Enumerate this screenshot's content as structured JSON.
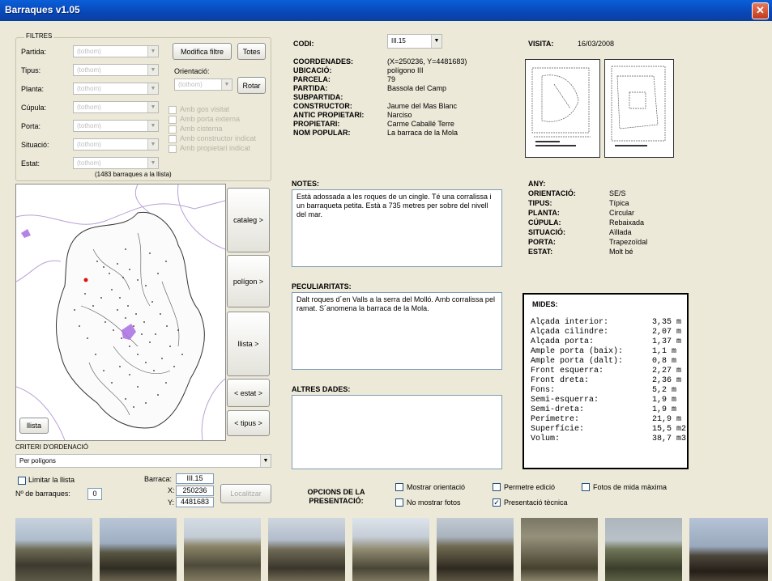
{
  "window": {
    "title": "Barraques v1.05"
  },
  "filters": {
    "group_label": "FILTRES",
    "rows": [
      {
        "label": "Partida:",
        "value": "(tothom)"
      },
      {
        "label": "Tipus:",
        "value": "(tothom)"
      },
      {
        "label": "Planta:",
        "value": "(tothom)"
      },
      {
        "label": "Cúpula:",
        "value": "(tothom)"
      },
      {
        "label": "Porta:",
        "value": "(tothom)"
      },
      {
        "label": "Situació:",
        "value": "(tothom)"
      },
      {
        "label": "Estat:",
        "value": "(tothom)"
      }
    ],
    "modify_button": "Modifica filtre",
    "all_button": "Totes",
    "orientation_label": "Orientació:",
    "orientation_value": "(tothom)",
    "rotate_button": "Rotar",
    "checkboxes": [
      "Amb gos visitat",
      "Amb porta externa",
      "Amb cisterna",
      "Amb constructor indicat",
      "Amb propietari indicat"
    ],
    "count_text": "(1483 barraques a la llista)"
  },
  "map_buttons": [
    "cataleg >",
    "polígon >",
    "llista >",
    "< estat >",
    "< tipus >"
  ],
  "llista_button": "llista",
  "sort": {
    "label": "CRITERI D'ORDENACIÓ",
    "value": "Per polígons"
  },
  "bottom_left": {
    "limit_label": "Limitar la llista",
    "count_label": "Nº de barraques:",
    "count_value": "0",
    "barraca_label": "Barraca:",
    "barraca_value": "III.15",
    "x_label": "X:",
    "x_value": "250236",
    "y_label": "Y:",
    "y_value": "4481683",
    "locate_button": "Localitzar"
  },
  "details": {
    "code_label": "CODI:",
    "code_value": "III.15",
    "fields": [
      {
        "label": "COORDENADES:",
        "value": "(X=250236, Y=4481683)"
      },
      {
        "label": "UBICACIÓ:",
        "value": "polígono III"
      },
      {
        "label": "PARCELA:",
        "value": "79"
      },
      {
        "label": "PARTIDA:",
        "value": "Bassola del Camp"
      },
      {
        "label": "SUBPARTIDA:",
        "value": ""
      },
      {
        "label": "CONSTRUCTOR:",
        "value": "Jaume del Mas Blanc"
      },
      {
        "label": "ANTIC PROPIETARI:",
        "value": "Narciso"
      },
      {
        "label": "PROPIETARI:",
        "value": "Carme Caballé Terre"
      },
      {
        "label": "NOM POPULAR:",
        "value": "La barraca de la Mola"
      }
    ]
  },
  "visit": {
    "label": "VISITA:",
    "value": "16/03/2008"
  },
  "notes": {
    "label": "NOTES:",
    "text": "Està adossada a les roques de un cingle. Té una corralissa i un barraqueta petita. Està a 735 metres per sobre del nivell del mar."
  },
  "peculiarities": {
    "label": "PECULIARITATS:",
    "text": "Dalt roques d´en Valls a la serra del Molló. Amb corralissa pel ramat. S´anomena la barraca de la Mola."
  },
  "other": {
    "label": "ALTRES DADES:",
    "text": ""
  },
  "attributes": [
    {
      "label": "ANY:",
      "value": ""
    },
    {
      "label": "ORIENTACIÓ:",
      "value": "SE/S"
    },
    {
      "label": "TIPUS:",
      "value": "Típica"
    },
    {
      "label": "PLANTA:",
      "value": "Circular"
    },
    {
      "label": "CÚPULA:",
      "value": "Rebaixada"
    },
    {
      "label": "SITUACIÓ:",
      "value": "Aïllada"
    },
    {
      "label": "PORTA:",
      "value": "Trapezoïdal"
    },
    {
      "label": "ESTAT:",
      "value": "Molt bé"
    }
  ],
  "measures": {
    "title": "MIDES:",
    "rows": [
      {
        "label": "Alçada interior:",
        "value": "3,35 m"
      },
      {
        "label": "Alçada cilindre:",
        "value": "2,07 m"
      },
      {
        "label": "Alçada porta:",
        "value": "1,37 m"
      },
      {
        "label": "Ample porta (baix):",
        "value": "1,1 m"
      },
      {
        "label": "Ample porta (dalt):",
        "value": "0,8 m"
      },
      {
        "label": "Front esquerra:",
        "value": "2,27 m"
      },
      {
        "label": "Front dreta:",
        "value": "2,36 m"
      },
      {
        "label": "Fons:",
        "value": "5,2 m"
      },
      {
        "label": "Semi-esquerra:",
        "value": "1,9 m"
      },
      {
        "label": "Semi-dreta:",
        "value": "1,9 m"
      },
      {
        "label": "Perímetre:",
        "value": "21,9 m"
      },
      {
        "label": "Superfície:",
        "value": "15,5 m2"
      },
      {
        "label": "Volum:",
        "value": "38,7 m3"
      }
    ]
  },
  "options": {
    "title_line1": "OPCIONS DE LA",
    "title_line2": "PRESENTACIÓ:",
    "show_orientation": "Mostrar orientació",
    "hide_photos": "No mostrar fotos",
    "allow_edit": "Permetre edició",
    "tech_presentation": "Presentació tècnica",
    "max_photos": "Fotos de mida màxima"
  },
  "colors": {
    "titlebar": "#0a5fd8",
    "map_highlight": "#a86ce0",
    "map_red": "#e01010"
  }
}
